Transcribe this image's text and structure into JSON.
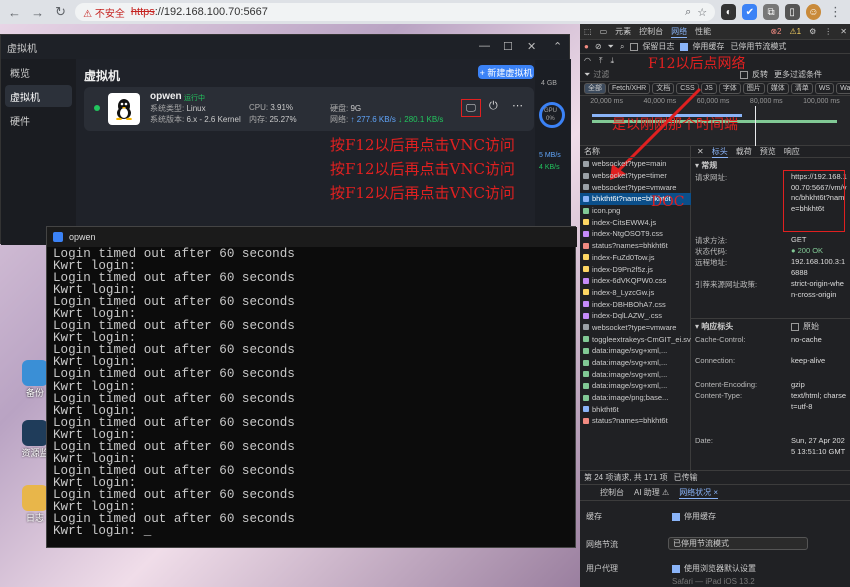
{
  "browser": {
    "insecure_label": "不安全",
    "url_scheme": "https",
    "url_rest": "://192.168.100.70:5667"
  },
  "desktop": {
    "icon1_label": "备份",
    "icon2_label": "资源监",
    "icon3_label": "日志"
  },
  "vm_window": {
    "title": "虚拟机",
    "sidebar": [
      {
        "label": "概览"
      },
      {
        "label": "虚拟机"
      },
      {
        "label": "硬件"
      }
    ],
    "page_title": "虚拟机",
    "new_button": "+ 新建虚拟机",
    "vm": {
      "name": "opwen",
      "state": "运行中",
      "system_type_label": "系统类型:",
      "system_type": "Linux",
      "system_version_label": "系统版本:",
      "system_version": "6.x - 2.6 Kernel",
      "cpu_label": "CPU:",
      "cpu": "3.91%",
      "mem_label": "内存:",
      "mem": "25.27%",
      "disk_label": "硬盘:",
      "disk": "9G",
      "net_label": "网络:",
      "net_up": "↑ 277.6 KB/s",
      "net_down": "↓ 280.1 KB/s"
    },
    "right_gauge": {
      "v1": "4 GB",
      "v2": "GPU",
      "v3": "0%",
      "v4": "5 MB/s",
      "v5": "4 KB/s"
    }
  },
  "annotations": {
    "main": "按F12以后再点击VNC访问",
    "devtools": "F12以后点网络",
    "connect": "是以刚刚那个时间端",
    "doc": "DOC"
  },
  "terminal": {
    "title": "opwen",
    "lines": [
      "Login timed out after 60 seconds",
      "Kwrt login:",
      "Login timed out after 60 seconds",
      "Kwrt login:",
      "Login timed out after 60 seconds",
      "Kwrt login:",
      "Login timed out after 60 seconds",
      "Kwrt login:",
      "Login timed out after 60 seconds",
      "Kwrt login:",
      "Login timed out after 60 seconds",
      "Kwrt login:",
      "Login timed out after 60 seconds",
      "Kwrt login:",
      "Login timed out after 60 seconds",
      "Kwrt login:",
      "Login timed out after 60 seconds",
      "Kwrt login:",
      "Login timed out after 60 seconds",
      "Kwrt login:",
      "Login timed out after 60 seconds",
      "Kwrt login:",
      "Login timed out after 60 seconds",
      "Kwrt login: _"
    ]
  },
  "devtools": {
    "tabs": [
      "元素",
      "控制台",
      "网络",
      "性能"
    ],
    "toolbar": {
      "preserve_log": "保留日志",
      "disable_cache": "停用缓存",
      "throttle": "已停用节流模式"
    },
    "filter": {
      "placeholder": "过滤",
      "invert": "反转",
      "more": "更多过滤条件"
    },
    "types": [
      "全部",
      "Fetch/XHR",
      "文档",
      "CSS",
      "JS",
      "字体",
      "图片",
      "媒体",
      "清单",
      "WS",
      "Wasm",
      "其他"
    ],
    "timeline": [
      "20,000 ms",
      "40,000 ms",
      "60,000 ms",
      "80,000 ms",
      "100,000 ms"
    ],
    "list_header": "名称",
    "requests": [
      "websocket?type=main",
      "websocket?type=timer",
      "websocket?type=vmware",
      "bhktht6t?name=bhkht6t",
      "icon.png",
      "index-CitsEWW4.js",
      "index-NtgOSOT9.css",
      "status?names=bhkht6t",
      "index-FuZd0Tow.js",
      "index-D9Pn2f5z.js",
      "index-6dVKQPW0.css",
      "index-8_LyzcGw.js",
      "index-DBHBOhA7.css",
      "index-DqlLAZW_.css",
      "websocket?type=vmware",
      "toggleextrakeys-CmGIT_ei.svg",
      "data:image/svg+xml,...",
      "data:image/svg+xml,...",
      "data:image/svg+xml,...",
      "data:image/svg+xml,...",
      "data:image/png;base...",
      "bhktht6t",
      "status?names=bhkht6t"
    ],
    "detail_tabs": [
      "标头",
      "载荷",
      "预览",
      "响应"
    ],
    "general_label": "▾ 常规",
    "general": [
      {
        "k": "请求网址:",
        "v": "https://192.168.100.70:5667/vm/vnc/bhkht6t?name=bhkht6t"
      },
      {
        "k": "请求方法:",
        "v": "GET"
      },
      {
        "k": "状态代码:",
        "v": "● 200 OK"
      },
      {
        "k": "远程地址:",
        "v": "192.168.100.3:16888"
      },
      {
        "k": "引荐来源网址政策:",
        "v": "strict-origin-when-cross-origin"
      }
    ],
    "response_headers_label": "▾ 响应标头",
    "raw_label": "原始",
    "response": [
      {
        "k": "Cache-Control:",
        "v": "no-cache"
      },
      {
        "k": "Connection:",
        "v": "keep-alive"
      },
      {
        "k": "Content-Encoding:",
        "v": "gzip"
      },
      {
        "k": "Content-Type:",
        "v": "text/html; charset=utf-8"
      },
      {
        "k": "Date:",
        "v": "Sun, 27 Apr 2025 13:51:10 GMT"
      }
    ],
    "status_bar": {
      "count": "第 24 项请求, 共 171 项",
      "transferred": "已传输"
    },
    "drawer": {
      "tabs": [
        "控制台",
        "AI 助理 ⚠",
        "网络状况 ×"
      ],
      "cache_label": "缓存",
      "cache_value": "停用缓存",
      "throttle_label": "网络节流",
      "throttle_value": "已停用节流模式",
      "ua_label": "用户代理",
      "ua_value": "使用浏览器默认设置",
      "ua_sub": "Safari — iPad iOS 13.2"
    }
  }
}
